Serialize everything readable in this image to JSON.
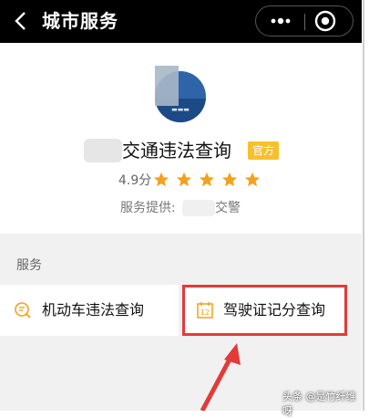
{
  "titlebar": {
    "title": "城市服务",
    "back_icon": "chevron-left-icon",
    "more_icon": "more-dots-icon",
    "close_icon": "target-close-icon"
  },
  "service": {
    "name": "交通违法查询",
    "official_badge": "官方",
    "rating": "4.9分",
    "stars": 5,
    "provider_label": "服务提供:",
    "provider_tail": "交警"
  },
  "services": {
    "heading": "服务",
    "items": [
      {
        "label": "机动车违法查询",
        "icon": "search-document-icon"
      },
      {
        "label": "驾驶证记分查询",
        "icon": "calendar-12-icon"
      }
    ]
  },
  "annotation": {
    "highlight_color": "#e33a3a"
  },
  "watermark": "头条 @是竹纤维呀",
  "colors": {
    "titlebar": "#000000",
    "accent_orange": "#f4a11d",
    "badge": "#f7c12b"
  }
}
